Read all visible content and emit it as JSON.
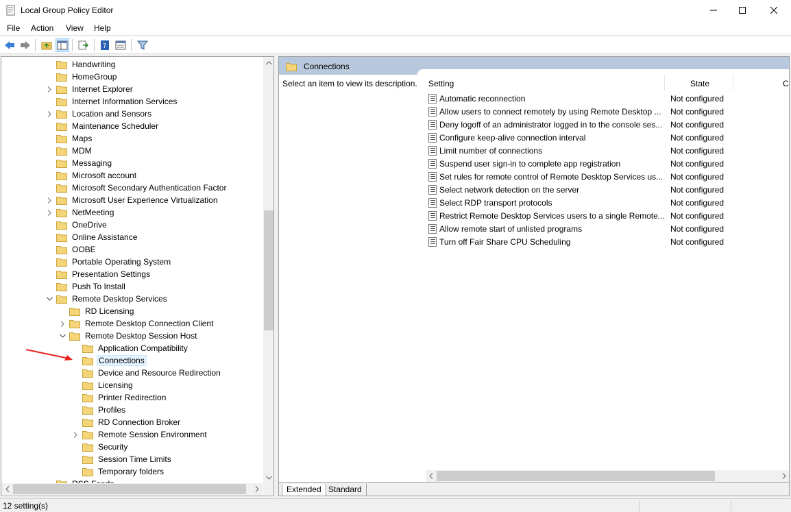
{
  "window": {
    "title": "Local Group Policy Editor",
    "icon": "policy-editor-icon"
  },
  "menu": [
    "File",
    "Action",
    "View",
    "Help"
  ],
  "toolbar": {
    "buttons": [
      "back-arrow-icon",
      "forward-arrow-icon",
      "up-folder-icon",
      "show-hide-tree-icon",
      "export-list-icon",
      "help-icon",
      "properties-icon",
      "filter-icon"
    ]
  },
  "tree": {
    "items": [
      {
        "label": "Handwriting",
        "expander": ""
      },
      {
        "label": "HomeGroup",
        "expander": ""
      },
      {
        "label": "Internet Explorer",
        "expander": "›"
      },
      {
        "label": "Internet Information Services",
        "expander": ""
      },
      {
        "label": "Location and Sensors",
        "expander": "›"
      },
      {
        "label": "Maintenance Scheduler",
        "expander": ""
      },
      {
        "label": "Maps",
        "expander": ""
      },
      {
        "label": "MDM",
        "expander": ""
      },
      {
        "label": "Messaging",
        "expander": ""
      },
      {
        "label": "Microsoft account",
        "expander": ""
      },
      {
        "label": "Microsoft Secondary Authentication Factor",
        "expander": ""
      },
      {
        "label": "Microsoft User Experience Virtualization",
        "expander": "›"
      },
      {
        "label": "NetMeeting",
        "expander": "›"
      },
      {
        "label": "OneDrive",
        "expander": ""
      },
      {
        "label": "Online Assistance",
        "expander": ""
      },
      {
        "label": "OOBE",
        "expander": ""
      },
      {
        "label": "Portable Operating System",
        "expander": ""
      },
      {
        "label": "Presentation Settings",
        "expander": ""
      },
      {
        "label": "Push To Install",
        "expander": ""
      },
      {
        "label": "Remote Desktop Services",
        "expander": "⌄"
      },
      {
        "label": "RD Licensing",
        "expander": ""
      },
      {
        "label": "Remote Desktop Connection Client",
        "expander": "›"
      },
      {
        "label": "Remote Desktop Session Host",
        "expander": "⌄"
      },
      {
        "label": "Application Compatibility",
        "expander": ""
      },
      {
        "label": "Connections",
        "expander": ""
      },
      {
        "label": "Device and Resource Redirection",
        "expander": ""
      },
      {
        "label": "Licensing",
        "expander": ""
      },
      {
        "label": "Printer Redirection",
        "expander": ""
      },
      {
        "label": "Profiles",
        "expander": ""
      },
      {
        "label": "RD Connection Broker",
        "expander": ""
      },
      {
        "label": "Remote Session Environment",
        "expander": "›"
      },
      {
        "label": "Security",
        "expander": ""
      },
      {
        "label": "Session Time Limits",
        "expander": ""
      },
      {
        "label": "Temporary folders",
        "expander": ""
      },
      {
        "label": "RSS Feeds",
        "expander": ""
      }
    ],
    "selected": "Connections"
  },
  "right": {
    "header_title": "Connections",
    "description": "Select an item to view its description.",
    "columns": {
      "setting": "Setting",
      "state": "State",
      "comment": "C"
    },
    "rows": [
      {
        "name": "Automatic reconnection",
        "state": "Not configured"
      },
      {
        "name": "Allow users to connect remotely by using Remote Desktop Services",
        "state": "Not configured"
      },
      {
        "name": "Deny logoff of an administrator logged in to the console session",
        "state": "Not configured"
      },
      {
        "name": "Configure keep-alive connection interval",
        "state": "Not configured"
      },
      {
        "name": "Limit number of connections",
        "state": "Not configured"
      },
      {
        "name": "Suspend user sign-in to complete app registration",
        "state": "Not configured"
      },
      {
        "name": "Set rules for remote control of Remote Desktop Services user sessions",
        "state": "Not configured"
      },
      {
        "name": "Select network detection on the server",
        "state": "Not configured"
      },
      {
        "name": "Select RDP transport protocols",
        "state": "Not configured"
      },
      {
        "name": "Restrict Remote Desktop Services users to a single Remote Desktop Services session",
        "state": "Not configured"
      },
      {
        "name": "Allow remote start of unlisted programs",
        "state": "Not configured"
      },
      {
        "name": "Turn off Fair Share CPU Scheduling",
        "state": "Not configured"
      }
    ],
    "tabs": [
      "Extended",
      "Standard"
    ]
  },
  "status": {
    "text": "12 setting(s)"
  },
  "colors": {
    "accent_header": "#b9c9dd",
    "folder": "#f5d57a",
    "annotation_arrow": "#e8231e",
    "selection": "#e5f3ff"
  }
}
